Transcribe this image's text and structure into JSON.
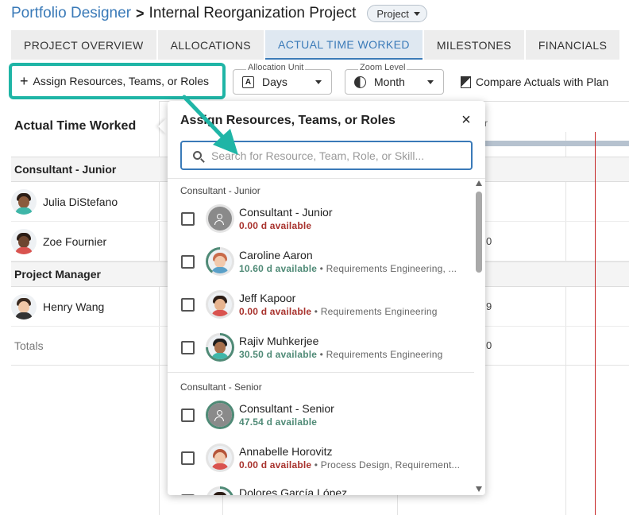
{
  "header": {
    "app_name": "Portfolio Designer",
    "separator": ">",
    "project_title": "Internal Reorganization Project",
    "project_type": "Project"
  },
  "tabs": [
    {
      "label": "PROJECT OVERVIEW",
      "active": false
    },
    {
      "label": "ALLOCATIONS",
      "active": false
    },
    {
      "label": "ACTUAL TIME WORKED",
      "active": true
    },
    {
      "label": "MILESTONES",
      "active": false
    },
    {
      "label": "FINANCIALS",
      "active": false
    }
  ],
  "toolbar": {
    "assign_label": "Assign Resources, Teams, or Roles",
    "allocation_unit_label": "Allocation Unit",
    "allocation_unit_value": "Days",
    "zoom_level_label": "Zoom Level",
    "zoom_level_value": "Month",
    "compare_label": "Compare Actuals with Plan"
  },
  "grid": {
    "title": "Actual Time Worked",
    "header_partial": "r",
    "sections": [
      {
        "label": "Consultant - Junior"
      },
      {
        "label": "Project Manager"
      }
    ],
    "people": [
      {
        "name": "Julia DiStefano",
        "value": ""
      },
      {
        "name": "Zoe Fournier",
        "value": "0"
      },
      {
        "name": "Henry Wang",
        "value": "9"
      }
    ],
    "totals_label": "Totals",
    "totals_value": "0"
  },
  "popup": {
    "title": "Assign Resources, Teams, or Roles",
    "close": "×",
    "search_placeholder": "Search for Resource, Team, Role, or Skill...",
    "search_value": "",
    "groups": [
      {
        "label": "Consultant - Junior",
        "items": [
          {
            "name": "Consultant - Junior",
            "availability": "0.00 d available",
            "skills": ""
          },
          {
            "name": "Caroline Aaron",
            "availability": "10.60 d available",
            "skills": " • Requirements Engineering, ..."
          },
          {
            "name": "Jeff Kapoor",
            "availability": "0.00 d available",
            "skills": " • Requirements Engineering"
          },
          {
            "name": "Rajiv Muhkerjee",
            "availability": "30.50 d available",
            "skills": " • Requirements Engineering"
          }
        ]
      },
      {
        "label": "Consultant - Senior",
        "items": [
          {
            "name": "Consultant - Senior",
            "availability": "47.54 d available",
            "skills": ""
          },
          {
            "name": "Annabelle Horovitz",
            "availability": "0.00 d available",
            "skills": " • Process Design, Requirement..."
          },
          {
            "name": "Dolores García López",
            "availability": "",
            "skills": ""
          }
        ]
      }
    ]
  },
  "colors": {
    "accent": "#3a7ab8",
    "highlight": "#1fb5a6",
    "unavailable": "#a8322d",
    "available": "#4f8a76",
    "today_line": "#c62828"
  },
  "icons": [
    "plus-icon",
    "calendar-icon",
    "zoom-icon",
    "compare-icon",
    "search-icon",
    "close-icon",
    "person-icon"
  ]
}
